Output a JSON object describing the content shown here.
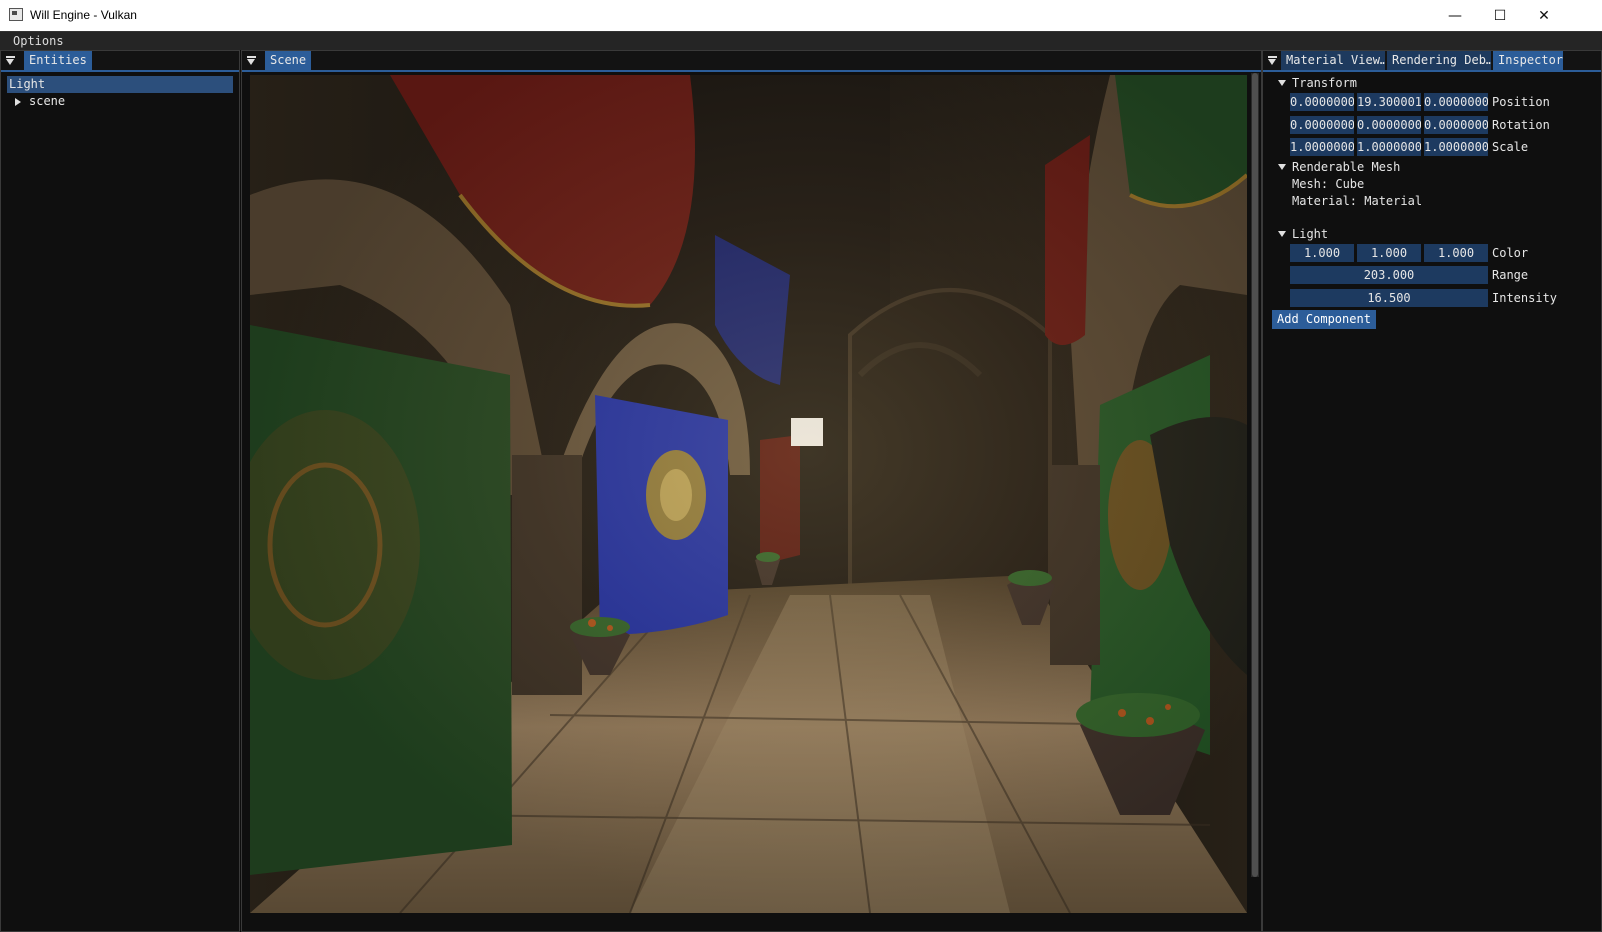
{
  "window": {
    "title": "Will Engine - Vulkan",
    "controls": {
      "minimize": "—",
      "maximize": "☐",
      "close": "✕"
    }
  },
  "menu": {
    "options": "Options"
  },
  "entities_panel": {
    "tab": "Entities",
    "tree": [
      {
        "label": "Light",
        "selected": true
      },
      {
        "label": "scene",
        "selected": false
      }
    ]
  },
  "scene_panel": {
    "tab": "Scene"
  },
  "inspector_panel": {
    "tabs": [
      "Material View…",
      "Rendering Deb…",
      "Inspector"
    ],
    "transform": {
      "header": "Transform",
      "position": {
        "label": "Position",
        "values": [
          "0.0000000",
          "19.300001",
          "0.0000000"
        ]
      },
      "rotation": {
        "label": "Rotation",
        "values": [
          "0.0000000",
          "0.0000000",
          "0.0000000"
        ]
      },
      "scale": {
        "label": "Scale",
        "values": [
          "1.0000000",
          "1.0000000",
          "1.0000000"
        ]
      }
    },
    "renderable_mesh": {
      "header": "Renderable Mesh",
      "mesh": "Mesh: Cube",
      "material": "Material: Material"
    },
    "light": {
      "header": "Light",
      "color": {
        "label": "Color",
        "values": [
          "1.000",
          "1.000",
          "1.000"
        ]
      },
      "range": {
        "label": "Range",
        "value": "203.000"
      },
      "intensity": {
        "label": "Intensity",
        "value": "16.500"
      }
    },
    "add_component": "Add Component"
  },
  "colors": {
    "accent": "#2c5d99",
    "field_bg": "#1d3a60",
    "panel_bg": "#0f0f0f"
  }
}
